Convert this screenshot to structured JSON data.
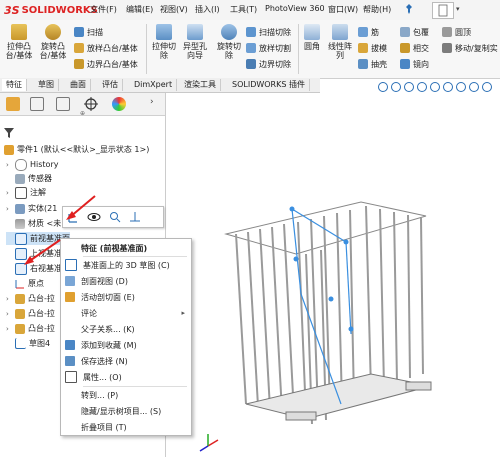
{
  "app": {
    "logo_ds": "3S",
    "logo_name": "SOLIDWORKS"
  },
  "menubar": {
    "items": [
      "文件(F)",
      "编辑(E)",
      "视图(V)",
      "插入(I)",
      "工具(T)",
      "PhotoView 360",
      "窗口(W)",
      "帮助(H)"
    ]
  },
  "ribbon": {
    "extrude_boss": "拉伸凸\n台/基体",
    "revolve_boss": "旋转凸\n台/基体",
    "sweep": "扫描",
    "loft": "放样凸台/基体",
    "boundary_boss": "边界凸台/基体",
    "extrude_cut": "拉伸切\n除",
    "hole_wizard": "异型孔\n向导",
    "revolve_cut": "旋转切\n除",
    "sweep_cut": "扫描切除",
    "loft_cut": "放样切割",
    "boundary_cut": "边界切除",
    "fillet": "圆角",
    "linear_pattern": "线性阵\n列",
    "rib": "筋",
    "draft": "拔模",
    "shell": "抽壳",
    "wrap": "包覆",
    "intersect": "相交",
    "mirror": "镜向",
    "dome": "圆顶",
    "move_copy": "移动/复制实"
  },
  "tabs": [
    "特征",
    "草图",
    "曲面",
    "评估",
    "DimXpert",
    "渲染工具",
    "SOLIDWORKS 插件"
  ],
  "active_tab": "特征",
  "tree": {
    "root": "零件1 (默认<<默认>_显示状态 1>)",
    "items": [
      "History",
      "传感器",
      "注解",
      "实体(21",
      "材质 <未",
      "前视基准面",
      "上视基准面",
      "右视基准面",
      "原点",
      "凸台-拉",
      "凸台-拉",
      "凸台-拉",
      "草图4"
    ]
  },
  "context_menu": {
    "header": "特征 (前视基准面)",
    "items": [
      {
        "label": "基准面上的 3D 草图 (C)",
        "icon": "3d-sketch-icon"
      },
      {
        "label": "剖面视图 (D)",
        "icon": "section-view-icon"
      },
      {
        "label": "活动剖切面 (E)",
        "icon": "live-section-icon"
      },
      {
        "label": "评论",
        "icon": "",
        "submenu": true
      },
      {
        "label": "父子关系... (K)",
        "icon": ""
      },
      {
        "label": "添加到收藏 (M)",
        "icon": "favorite-icon"
      },
      {
        "label": "保存选择 (N)",
        "icon": "save-selection-icon"
      },
      {
        "label": "属性... (O)",
        "icon": "properties-icon"
      },
      {
        "label": "转到... (P)",
        "icon": ""
      },
      {
        "label": "隐藏/显示树项目... (S)",
        "icon": ""
      },
      {
        "label": "折叠项目 (T)",
        "icon": ""
      }
    ]
  },
  "colors": {
    "accent": "#2b6fb5",
    "brand_red": "#d22222",
    "arrow_red": "#e02020",
    "highlight": "#cde3f7"
  }
}
